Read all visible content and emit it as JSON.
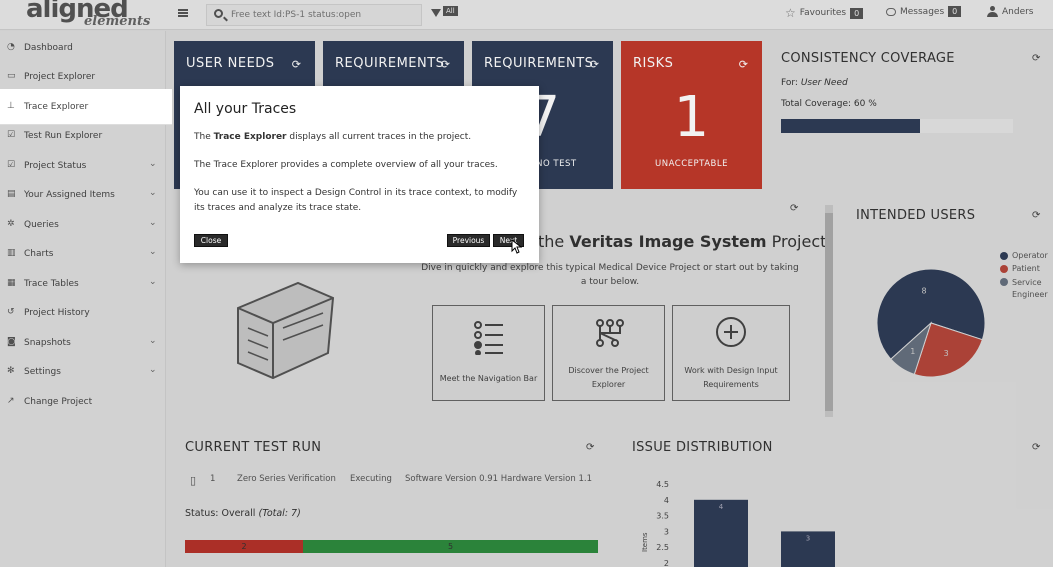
{
  "app": {
    "logo_main": "aligned",
    "logo_sub": "elements"
  },
  "topbar": {
    "search_placeholder": "Free text Id:PS-1 status:open",
    "filter_badge": "All",
    "favourites_label": "Favourites",
    "favourites_count": "0",
    "messages_label": "Messages",
    "messages_count": "0",
    "user_name": "Anders"
  },
  "sidebar": {
    "items": [
      {
        "label": "Dashboard",
        "icon": "dashboard-icon",
        "chevron": false
      },
      {
        "label": "Project Explorer",
        "icon": "folder-icon",
        "chevron": false
      },
      {
        "label": "Trace Explorer",
        "icon": "sitemap-icon",
        "chevron": false,
        "active": true
      },
      {
        "label": "Test Run Explorer",
        "icon": "checklist-icon",
        "chevron": false
      },
      {
        "label": "Project Status",
        "icon": "tasks-icon",
        "chevron": true
      },
      {
        "label": "Your Assigned Items",
        "icon": "inbox-icon",
        "chevron": true
      },
      {
        "label": "Queries",
        "icon": "cogs-icon",
        "chevron": true
      },
      {
        "label": "Charts",
        "icon": "bar-chart-icon",
        "chevron": true
      },
      {
        "label": "Trace Tables",
        "icon": "table-icon",
        "chevron": true
      },
      {
        "label": "Project History",
        "icon": "history-icon",
        "chevron": false
      },
      {
        "label": "Snapshots",
        "icon": "camera-icon",
        "chevron": true
      },
      {
        "label": "Settings",
        "icon": "gear-icon",
        "chevron": true
      },
      {
        "label": "Change Project",
        "icon": "external-link-icon",
        "chevron": false
      }
    ]
  },
  "tiles": [
    {
      "title": "USER NEEDS",
      "value": "",
      "subtitle": "",
      "color": "#2f3d57"
    },
    {
      "title": "REQUIREMENTS",
      "value": "",
      "subtitle": "",
      "color": "#2f3d57"
    },
    {
      "title": "REQUIREMENTS",
      "value": "7",
      "subtitle": "WITH NO TEST",
      "color": "#2f3d57"
    },
    {
      "title": "RISKS",
      "value": "1",
      "subtitle": "UNACCEPTABLE",
      "color": "#c0392b"
    }
  ],
  "coverage": {
    "title": "CONSISTENCY COVERAGE",
    "for_label": "For:",
    "for_value": "User Need",
    "total_label": "Total Coverage:",
    "total_value": "60 %",
    "fraction": 0.6
  },
  "welcome": {
    "heading_prefix": "the",
    "heading_bold": "Veritas Image System",
    "heading_suffix": "Project",
    "text": "Dive in quickly and explore this typical Medical Device Project or start out by taking a tour below.",
    "cards": [
      {
        "label": "Meet the Navigation Bar",
        "icon": "list-icon"
      },
      {
        "label": "Discover the Project Explorer",
        "icon": "tree-icon"
      },
      {
        "label": "Work with Design Input Requirements",
        "icon": "plus-circle-icon"
      }
    ]
  },
  "intended_users": {
    "title": "INTENDED USERS",
    "legend": [
      {
        "name": "Operator",
        "color": "#2f3d57"
      },
      {
        "name": "Patient",
        "color": "#b5463a"
      },
      {
        "name": "Service Engineer",
        "color": "#66707f"
      }
    ],
    "slice_labels": [
      "8",
      "3",
      "1"
    ]
  },
  "test_run": {
    "title": "CURRENT TEST RUN",
    "row_id": "1",
    "row_name": "Zero Series Verification",
    "row_state": "Executing",
    "row_version": "Software Version 0.91 Hardware Version 1.1",
    "status_label": "Status: Overall",
    "status_total": "(Total: 7)",
    "failed": "2",
    "passed": "5",
    "failed_color": "#b5322a",
    "passed_color": "#2e8b3e"
  },
  "issue_distribution": {
    "title": "ISSUE DISTRIBUTION"
  },
  "chart_data": {
    "type": "bar",
    "title": "ISSUE DISTRIBUTION",
    "ylabel": "Items",
    "yticks": [
      "4.5",
      "4",
      "3.5",
      "3",
      "2.5",
      "2"
    ],
    "ylim": [
      2,
      4.5
    ],
    "values": [
      4,
      3
    ],
    "value_labels": [
      "4",
      "3"
    ]
  },
  "modal": {
    "title": "All your Traces",
    "p1_prefix": "The ",
    "p1_bold": "Trace Explorer",
    "p1_suffix": " displays all current traces in the project.",
    "p2": "The Trace Explorer provides a complete overview of all your traces.",
    "p3": "You can use it to inspect a Design Control in its trace context, to modify its traces and analyze its trace state.",
    "close_label": "Close",
    "previous_label": "Previous",
    "next_label": "Next"
  }
}
